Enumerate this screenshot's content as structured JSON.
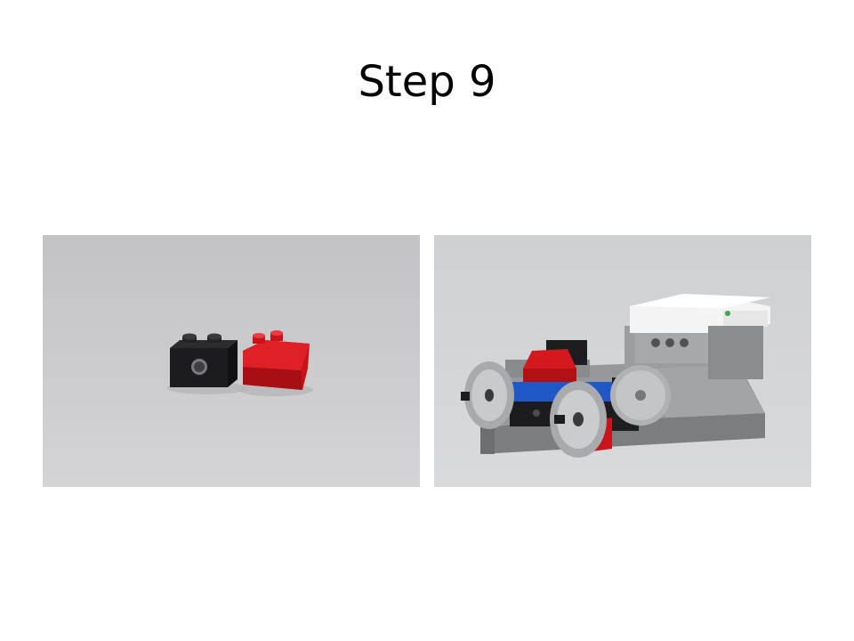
{
  "slide": {
    "title": "Step 9"
  },
  "photos": [
    {
      "label": "parts",
      "parts": [
        "black-technic-brick-1x2",
        "red-slope-brick-2x2"
      ],
      "colors": {
        "background": "#c9c9cb",
        "black_brick": "#1c1c1e",
        "red_slope": "#d0161c"
      }
    },
    {
      "label": "assembled-model",
      "colors": {
        "background": "#d2d3d5",
        "baseplate": "#8e8f91",
        "white_hub": "#f3f3f3",
        "blue_brick": "#1f5fcf",
        "red_slope": "#c9161b",
        "wheel": "#b9babc"
      }
    }
  ]
}
